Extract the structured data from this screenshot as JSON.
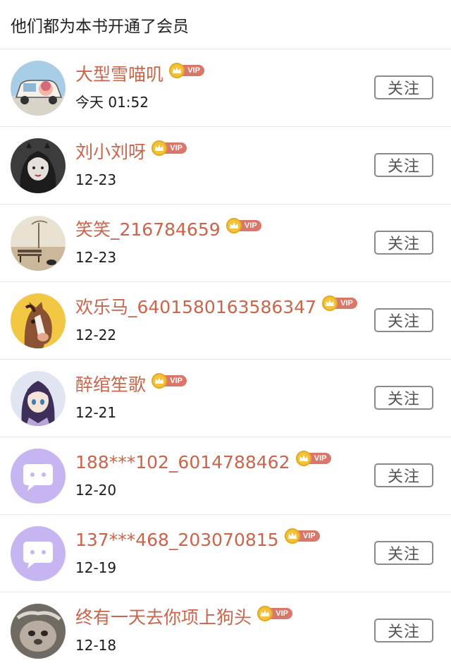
{
  "header": {
    "title": "他们都为本书开通了会员"
  },
  "badge": {
    "vip_label": "VIP"
  },
  "members": [
    {
      "name": "大型雪喵叽",
      "time": "今天 01:52",
      "follow_label": "关注",
      "avatar": "car-cartoon"
    },
    {
      "name": "刘小刘呀",
      "time": "12-23",
      "follow_label": "关注",
      "avatar": "dark-hair-girl"
    },
    {
      "name": "笑笑_216784659",
      "time": "12-23",
      "follow_label": "关注",
      "avatar": "bench-landscape"
    },
    {
      "name": "欢乐马_6401580163586347",
      "time": "12-22",
      "follow_label": "关注",
      "avatar": "horse-cartoon"
    },
    {
      "name": "醉绾笙歌",
      "time": "12-21",
      "follow_label": "关注",
      "avatar": "anime-girl"
    },
    {
      "name": "188***102_6014788462",
      "time": "12-20",
      "follow_label": "关注",
      "avatar": "default-chat"
    },
    {
      "name": "137***468_203070815",
      "time": "12-19",
      "follow_label": "关注",
      "avatar": "default-chat"
    },
    {
      "name": "终有一天去你项上狗头",
      "time": "12-18",
      "follow_label": "关注",
      "avatar": "animal-photo"
    }
  ],
  "colors": {
    "name": "#c9654a",
    "vip_pill": "#d9776a",
    "coin": "#f2c23a",
    "default_avatar": "#c7b5f1"
  }
}
